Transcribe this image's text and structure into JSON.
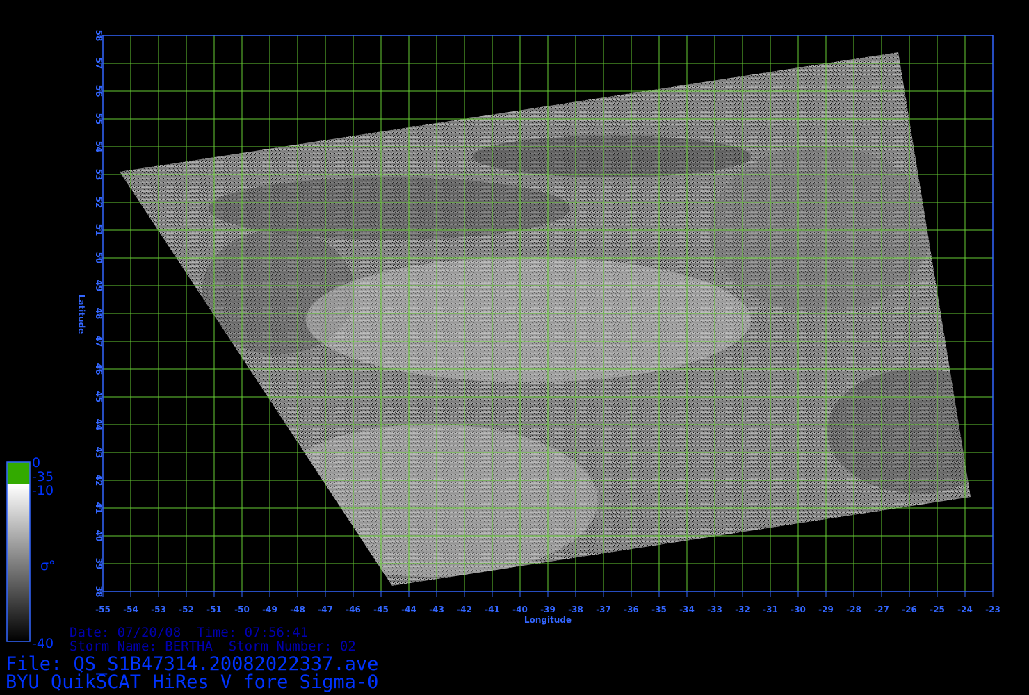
{
  "map": {
    "lon_range": [
      -55,
      -23
    ],
    "lat_range": [
      38,
      58
    ],
    "lon_ticks": [
      "-55",
      "-54",
      "-53",
      "-52",
      "-51",
      "-50",
      "-49",
      "-48",
      "-47",
      "-46",
      "-45",
      "-44",
      "-43",
      "-42",
      "-41",
      "-40",
      "-39",
      "-38",
      "-37",
      "-36",
      "-35",
      "-34",
      "-33",
      "-32",
      "-31",
      "-30",
      "-29",
      "-28",
      "-27",
      "-26",
      "-25",
      "-24",
      "-23"
    ],
    "lat_ticks": [
      "38",
      "39",
      "40",
      "41",
      "42",
      "43",
      "44",
      "45",
      "46",
      "47",
      "48",
      "49",
      "50",
      "51",
      "52",
      "53",
      "54",
      "55",
      "56",
      "57",
      "58"
    ],
    "xlabel": "Longitude",
    "ylabel": "Latitude",
    "grid_color": "#66cc33",
    "axis_color": "#3366ff",
    "swath_corners_lonlat": [
      [
        -54.4,
        53.1
      ],
      [
        -26.4,
        57.4
      ],
      [
        -23.8,
        41.4
      ],
      [
        -44.6,
        38.2
      ]
    ]
  },
  "colorbar": {
    "labels": [
      "0",
      "-35",
      "-10",
      "-40"
    ],
    "symbol": "σ°",
    "green_color": "#33aa00"
  },
  "info": {
    "date_line": "Date: 07/20/08  Time: 07:56:41",
    "storm_line": "Storm Name: BERTHA  Storm Number: 02",
    "file_line": "File: QS_S1B47314.20082022337.ave",
    "product_line": "BYU QuikSCAT HiRes V fore Sigma-0"
  },
  "colors": {
    "text_dark_blue": "#0000b0",
    "text_blue": "#0033ff"
  }
}
